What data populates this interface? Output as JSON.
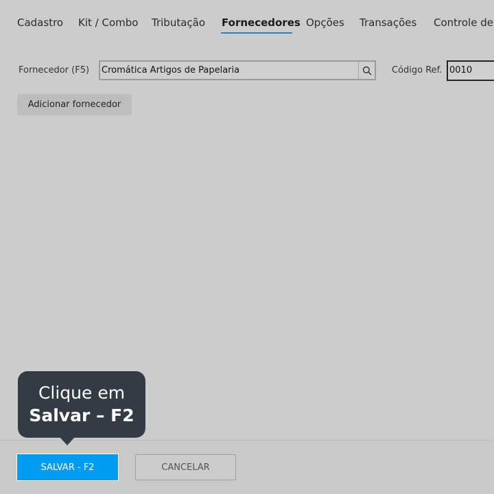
{
  "tabs": [
    {
      "label": "Cadastro"
    },
    {
      "label": "Kit / Combo"
    },
    {
      "label": "Tributação"
    },
    {
      "label": "Fornecedores",
      "active": true
    },
    {
      "label": "Opções"
    },
    {
      "label": "Transações"
    },
    {
      "label": "Controle de"
    }
  ],
  "form": {
    "supplier_label": "Fornecedor (F5)",
    "supplier_value": "Cromática Artigos de Papelaria",
    "code_label": "Código Ref.",
    "code_value": "0010",
    "add_supplier_label": "Adicionar fornecedor"
  },
  "footer": {
    "save_label": "SALVAR - F2",
    "cancel_label": "CANCELAR"
  },
  "tooltip": {
    "line1": "Clique em",
    "line2": "Salvar – F2"
  },
  "colors": {
    "background": "#cccccc",
    "accent": "#009cf4",
    "tab_underline": "#1e88d6",
    "tooltip_bg": "#333b45"
  },
  "icons": {
    "search": "search-icon"
  }
}
